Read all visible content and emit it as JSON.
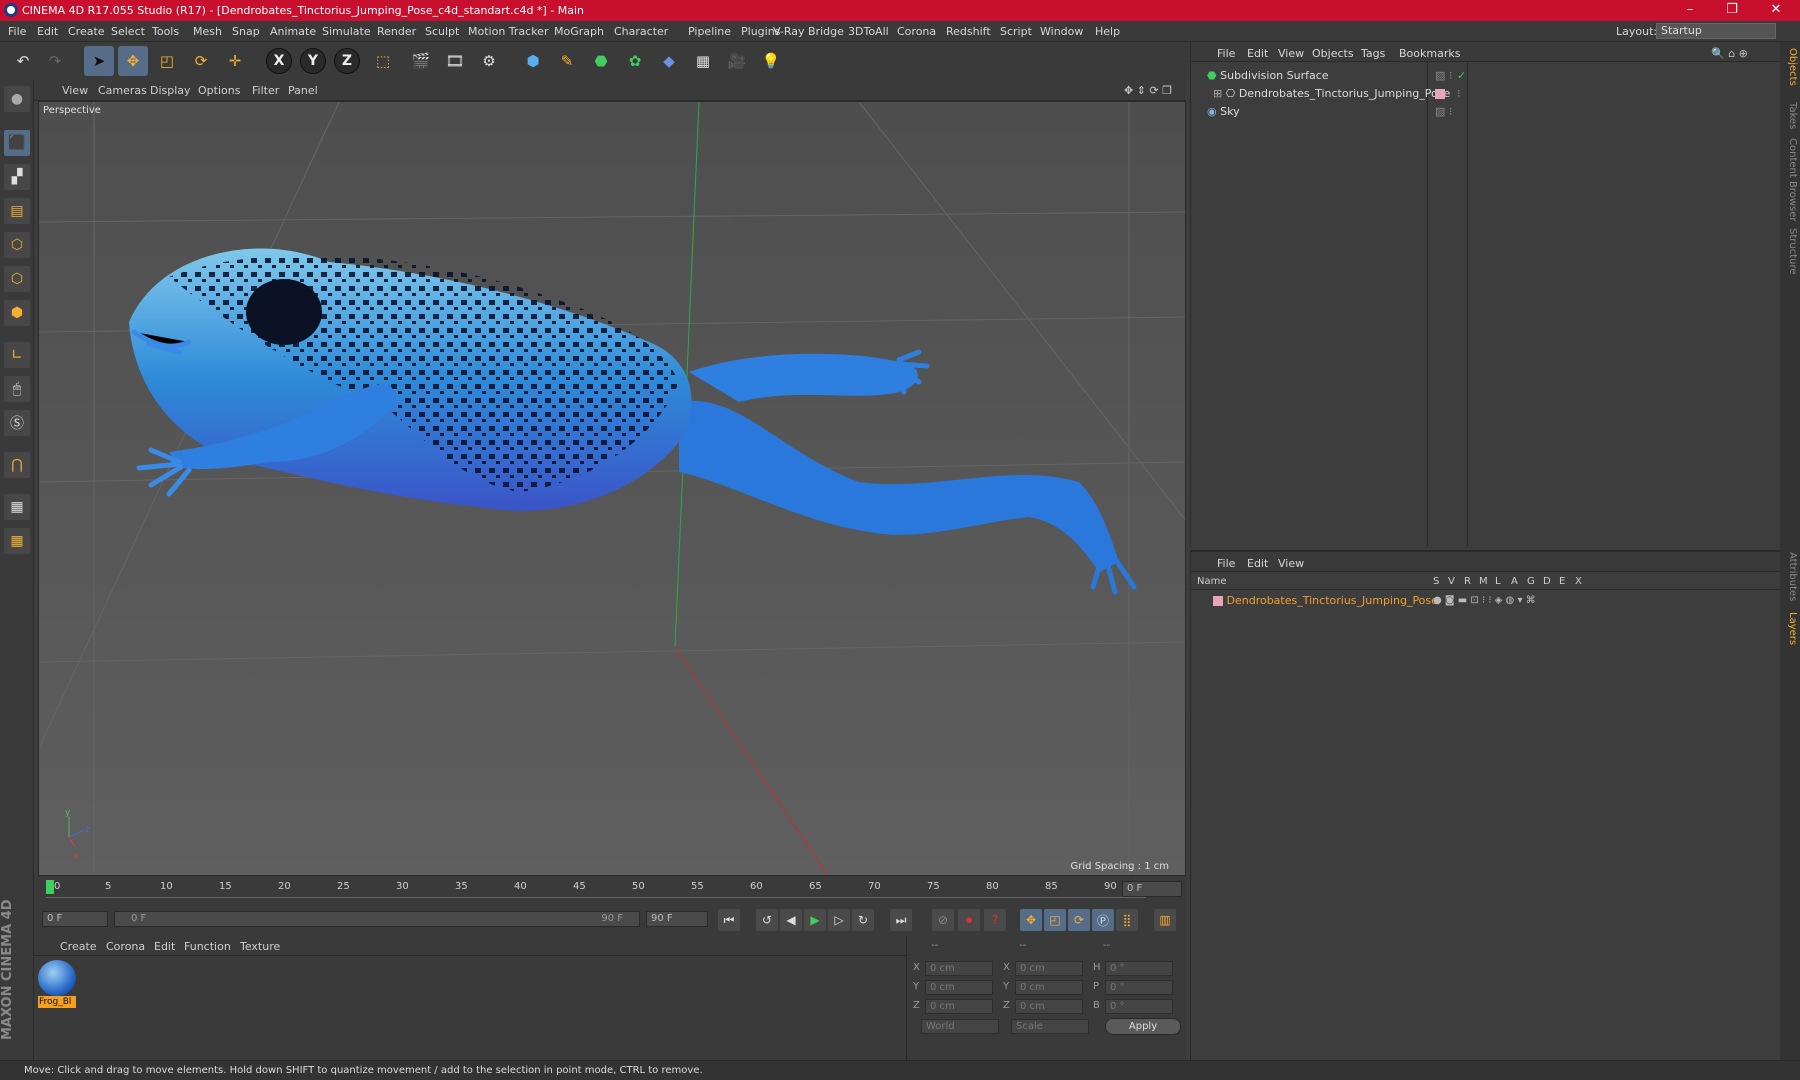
{
  "window": {
    "title": "CINEMA 4D R17.055 Studio (R17) - [Dendrobates_Tinctorius_Jumping_Pose_c4d_standart.c4d *] - Main",
    "minimize": "–",
    "maximize": "❐",
    "close": "✕"
  },
  "menubar": {
    "items": [
      "File",
      "Edit",
      "Create",
      "Select",
      "Tools",
      "Mesh",
      "Snap",
      "Animate",
      "Simulate",
      "Render",
      "Sculpt",
      "Motion Tracker",
      "MoGraph",
      "Character",
      "Pipeline",
      "Plugins",
      "V-Ray Bridge",
      "3DToAll",
      "Corona",
      "Redshift",
      "Script",
      "Window",
      "Help"
    ],
    "layout_label": "Layout:",
    "layout_value": "Startup"
  },
  "toolbar": {
    "axis_x": "X",
    "axis_y": "Y",
    "axis_z": "Z"
  },
  "viewport": {
    "menu": [
      "View",
      "Cameras",
      "Display",
      "Options",
      "Filter",
      "Panel"
    ],
    "camera_label": "Perspective",
    "grid_spacing": "Grid Spacing : 1 cm",
    "axis_y": "y",
    "axis_z": "z",
    "axis_x": "x"
  },
  "timeline": {
    "ticks": [
      "0",
      "5",
      "10",
      "15",
      "20",
      "25",
      "30",
      "35",
      "40",
      "45",
      "50",
      "55",
      "60",
      "65",
      "70",
      "75",
      "80",
      "85",
      "90"
    ],
    "current_frame": "0 F"
  },
  "transport": {
    "start_field": "0 F",
    "range_start": "0 F",
    "range_end": "90 F",
    "end_field": "90 F"
  },
  "material_panel": {
    "menu": [
      "Create",
      "Corona",
      "Edit",
      "Function",
      "Texture"
    ],
    "material_name": "Frog_Bl"
  },
  "coord_panel": {
    "headers": [
      "--",
      "--",
      "--"
    ],
    "rows": [
      {
        "a": "X",
        "av": "0 cm",
        "b": "X",
        "bv": "0 cm",
        "c": "H",
        "cv": "0 °"
      },
      {
        "a": "Y",
        "av": "0 cm",
        "b": "Y",
        "bv": "0 cm",
        "c": "P",
        "cv": "0 °"
      },
      {
        "a": "Z",
        "av": "0 cm",
        "b": "Z",
        "bv": "0 cm",
        "c": "B",
        "cv": "0 °"
      }
    ],
    "world_sel": "World",
    "scale_sel": "Scale",
    "apply": "Apply"
  },
  "object_manager": {
    "menu": [
      "File",
      "Edit",
      "View",
      "Objects",
      "Tags",
      "Bookmarks"
    ],
    "objects": [
      "Subdivision Surface",
      "Dendrobates_Tinctorius_Jumping_Pose",
      "Sky"
    ]
  },
  "layer_manager": {
    "menu": [
      "File",
      "Edit",
      "View"
    ],
    "columns": [
      "Name",
      "S",
      "V",
      "R",
      "M",
      "L",
      "A",
      "G",
      "D",
      "E",
      "X"
    ],
    "layer_name": "Dendrobates_Tinctorius_Jumping_Pose"
  },
  "right_tabs": [
    "Objects",
    "Takes",
    "Content Browser",
    "Structure",
    "Attributes",
    "Layers"
  ],
  "status": "Move: Click and drag to move elements. Hold down SHIFT to quantize movement / add to the selection in point mode, CTRL to remove.",
  "maxon_logo": "MAXON CINEMA 4D",
  "colors": {
    "title_bar": "#c8102e",
    "accent": "#566d8a",
    "frog": "#2f7fe0",
    "layer_name": "#f0a030"
  }
}
